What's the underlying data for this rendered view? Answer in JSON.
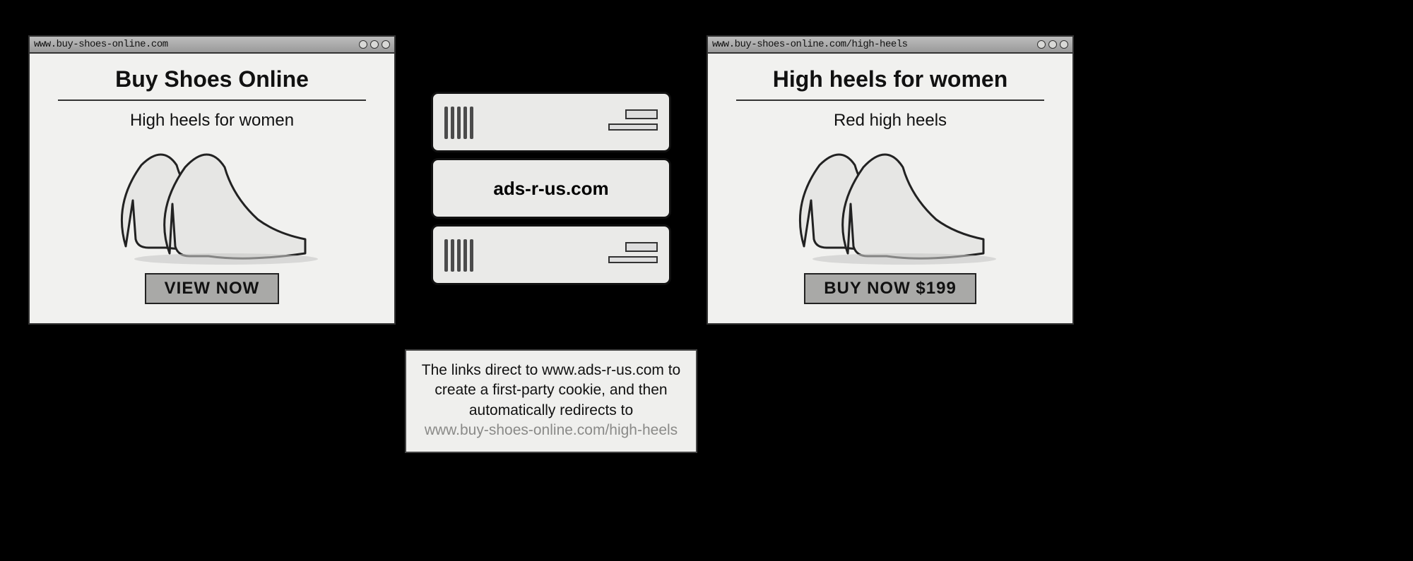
{
  "left_window": {
    "url": "www.buy-shoes-online.com",
    "title": "Buy Shoes Online",
    "subhead": "High heels for women",
    "cta": "VIEW NOW"
  },
  "right_window": {
    "url": "www.buy-shoes-online.com/high-heels",
    "title": "High heels for women",
    "subhead": "Red high heels",
    "cta": "BUY NOW $199"
  },
  "server": {
    "label": "ads-r-us.com"
  },
  "caption": {
    "line1": "The links direct to www.ads-r-us.com to create a first-party cookie, and then automatically redirects to",
    "line2": "www.buy-shoes-online.com/high-heels"
  }
}
